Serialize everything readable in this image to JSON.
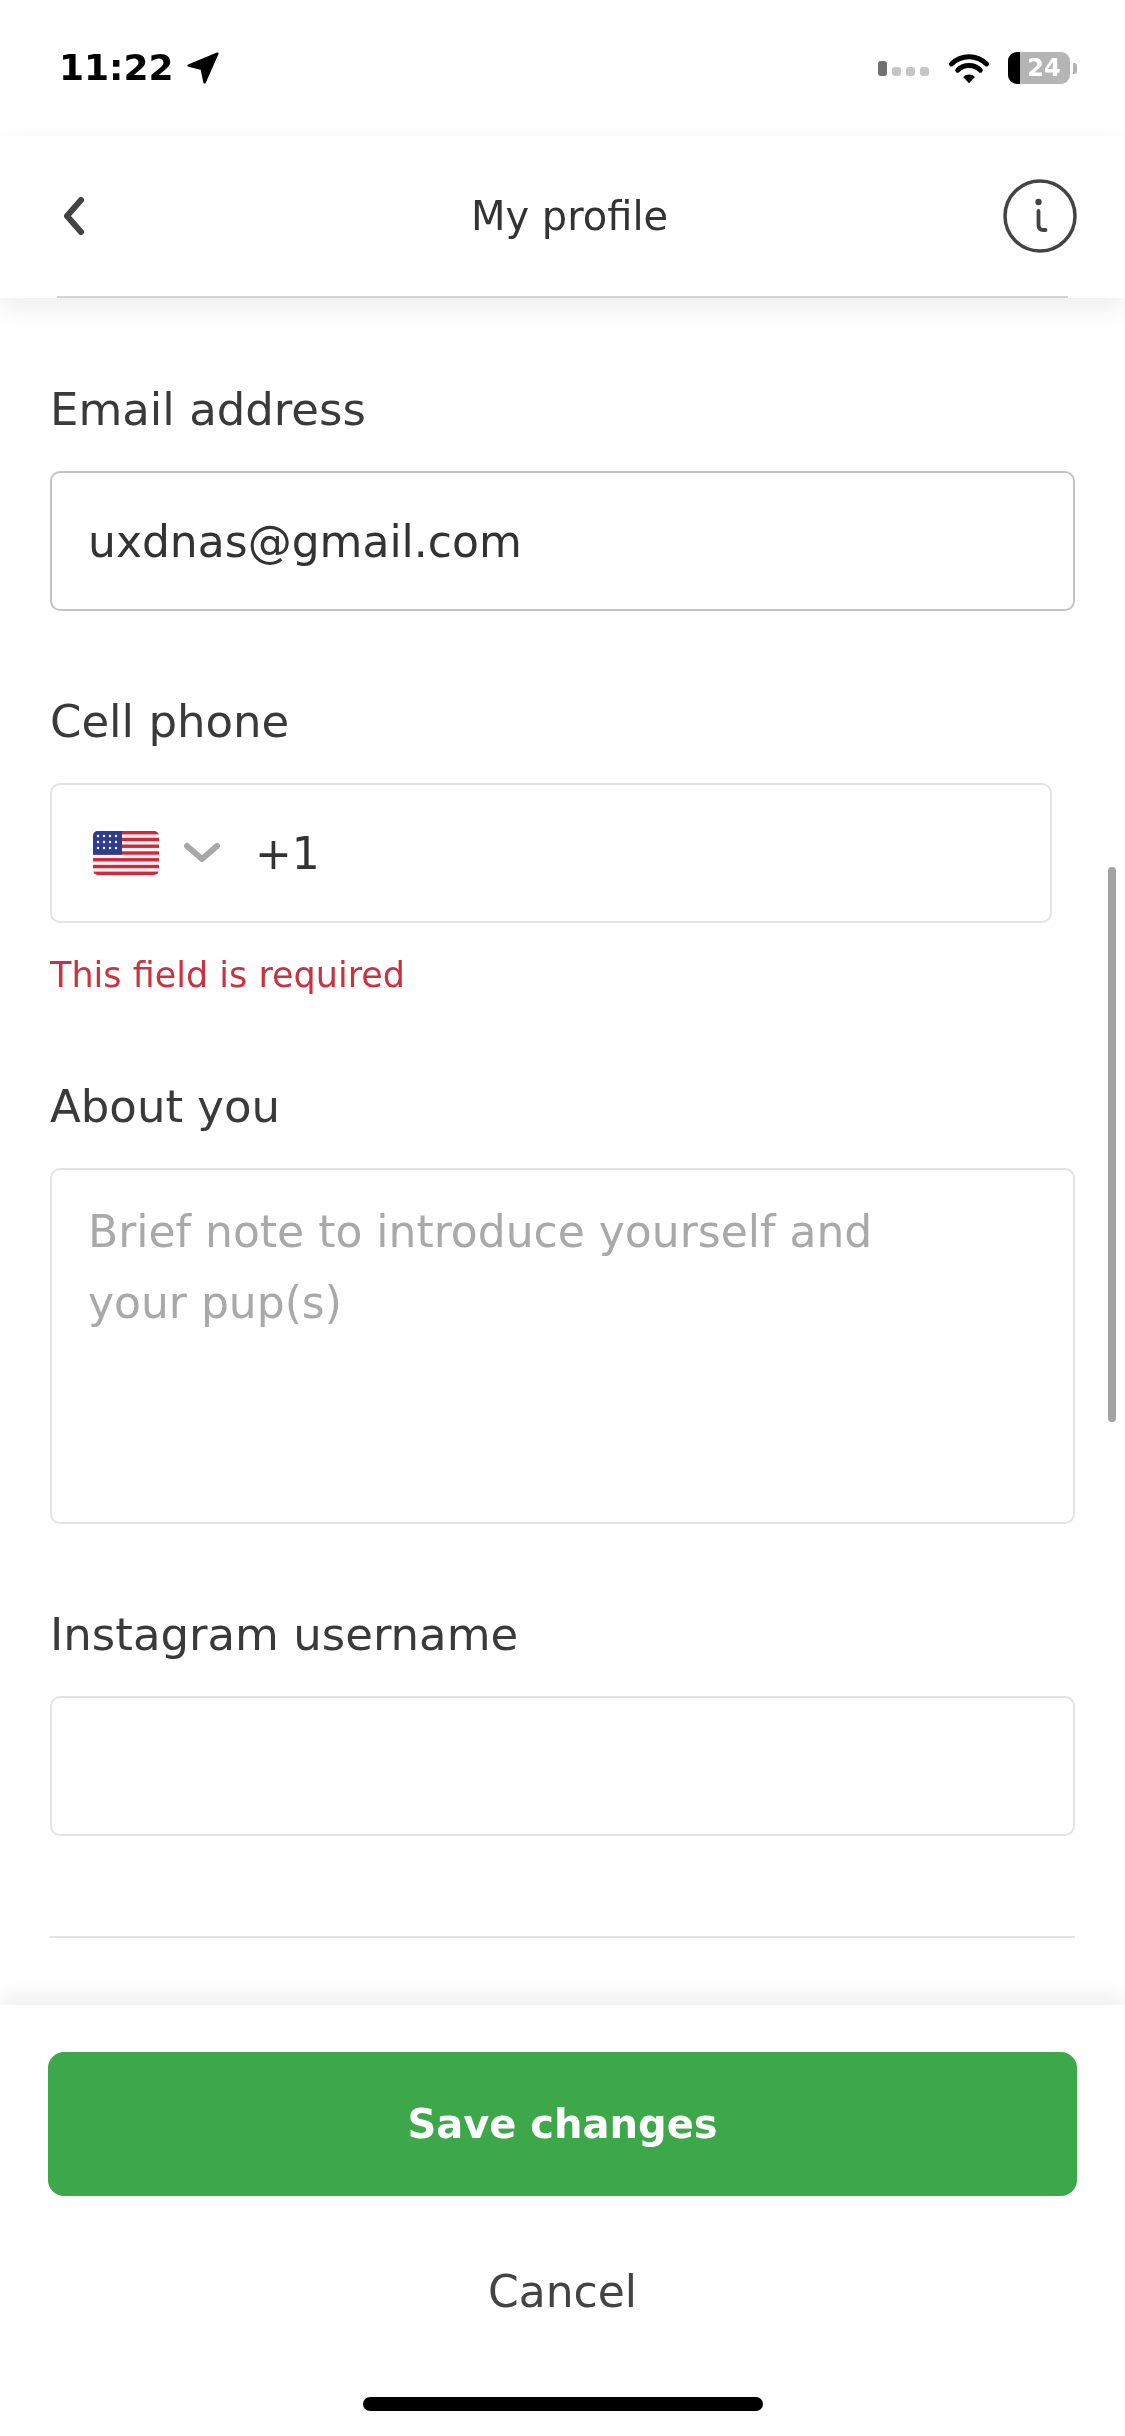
{
  "status_bar": {
    "time": "11:22",
    "battery": "24"
  },
  "nav": {
    "title": "My profile"
  },
  "fields": [
    {
      "kind": "text",
      "label": "Email address",
      "value": "uxdnas@gmail.com",
      "focused": true
    },
    {
      "kind": "phone",
      "label": "Cell phone",
      "value": "+1",
      "error": "This field is required",
      "focused": false
    },
    {
      "kind": "textarea",
      "label": "About you",
      "placeholder": "Brief note to introduce yourself and your pup(s)",
      "focused": false
    },
    {
      "kind": "text",
      "label": "Instagram username",
      "focused": false
    }
  ],
  "actions": {
    "primary": "Save changes",
    "secondary": "Cancel"
  }
}
